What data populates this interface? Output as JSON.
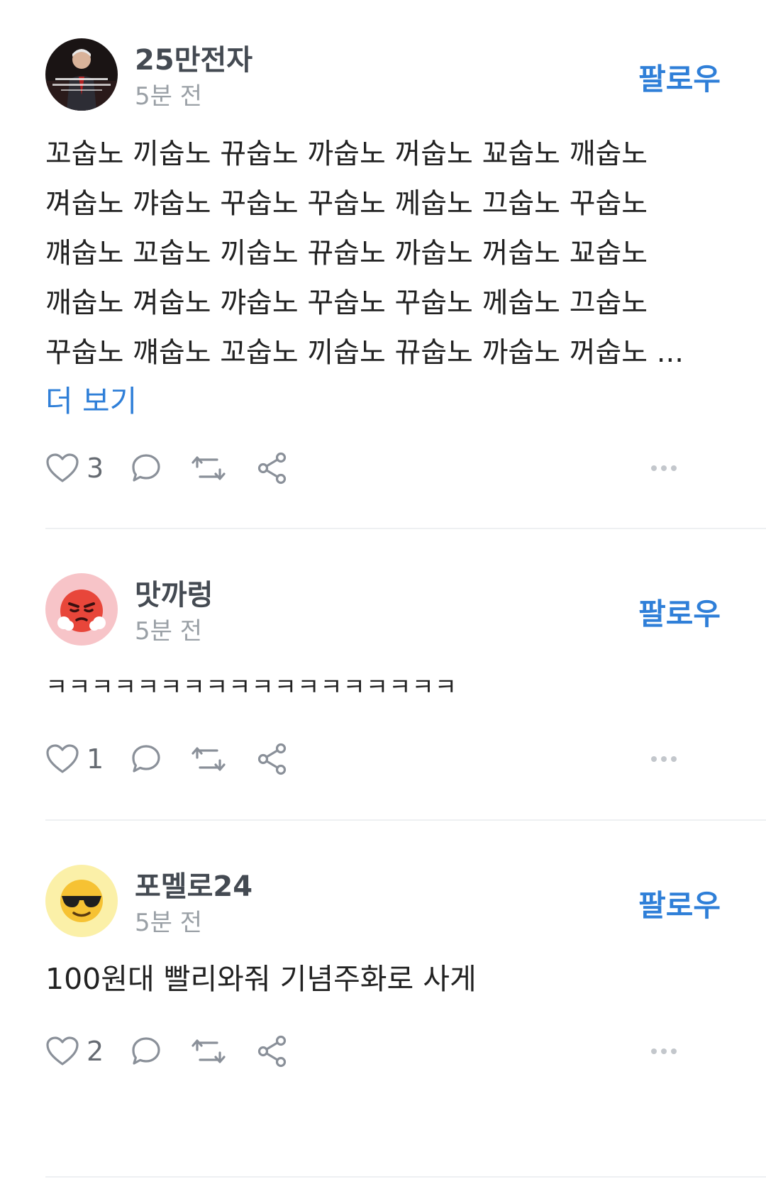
{
  "posts": [
    {
      "username": "25만전자",
      "time": "5분 전",
      "follow_label": "팔로우",
      "avatar_icon": "portrait-photo-icon",
      "content": "꼬숩노 끼숩노 뀨숩노 까숩노 꺼숩노 꾜숩노 깨숩노\n껴숩노 꺄숩노 꾸숩노 꾸숩노 께숩노 끄숩노 꾸숩노\n꺠숩노 꼬숩노 끼숩노 뀨숩노 까숩노 꺼숩노 꾜숩노\n깨숩노 껴숩노 꺄숩노 꾸숩노 꾸숩노 께숩노 끄숩노\n꾸숩노 꺠숩노 꼬숩노 끼숩노 뀨숩노 까숩노 꺼숩노 ...",
      "more_label": "더 보기",
      "likes": "3"
    },
    {
      "username": "맛까렁",
      "time": "5분 전",
      "follow_label": "팔로우",
      "avatar_icon": "angry-face-icon",
      "content": "ㅋㅋㅋㅋㅋㅋㅋㅋㅋㅋㅋㅋㅋㅋㅋㅋㅋㅋ",
      "likes": "1"
    },
    {
      "username": "포멜로24",
      "time": "5분 전",
      "follow_label": "팔로우",
      "avatar_icon": "sunglasses-face-icon",
      "content": "100원대 빨리와줘 기념주화로 사게",
      "likes": "2"
    }
  ],
  "colors": {
    "accent": "#2f7fd8",
    "text": "#222222",
    "muted": "#9aa0a6",
    "icon": "#8a9099",
    "divider": "#eef0f2"
  }
}
